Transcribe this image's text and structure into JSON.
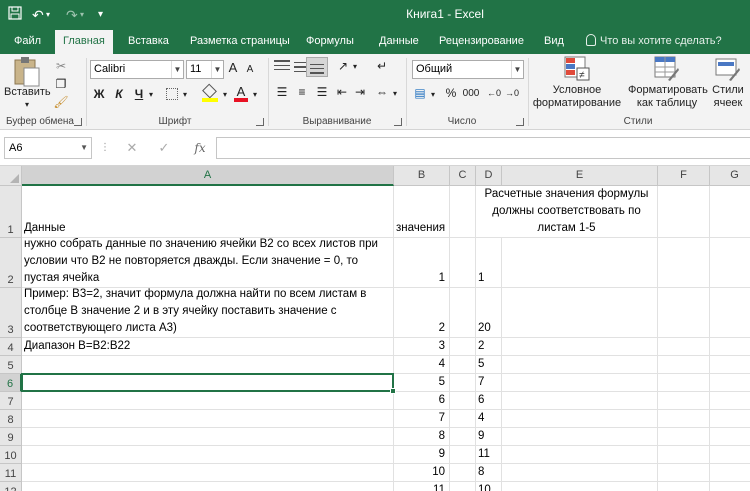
{
  "titlebar": {
    "title": "Книга1 - Excel"
  },
  "tabs": [
    {
      "label": "Файл",
      "active": false
    },
    {
      "label": "Главная",
      "active": true
    },
    {
      "label": "Вставка",
      "active": false
    },
    {
      "label": "Разметка страницы",
      "active": false
    },
    {
      "label": "Формулы",
      "active": false
    },
    {
      "label": "Данные",
      "active": false
    },
    {
      "label": "Рецензирование",
      "active": false
    },
    {
      "label": "Вид",
      "active": false
    }
  ],
  "tell_me": "Что вы хотите сделать?",
  "ribbon": {
    "clipboard": {
      "paste_label": "Вставить",
      "group_label": "Буфер обмена"
    },
    "font": {
      "font_name": "Calibri",
      "font_size": "11",
      "group_label": "Шрифт",
      "bold": "Ж",
      "italic": "К",
      "underline": "Ч",
      "grow": "A",
      "shrink": "A"
    },
    "alignment": {
      "group_label": "Выравнивание"
    },
    "number": {
      "format": "Общий",
      "group_label": "Число",
      "percent": "%",
      "thousands": "000"
    },
    "styles": {
      "conditional_line1": "Условное",
      "conditional_line2": "форматирование",
      "table_line1": "Форматировать",
      "table_line2": "как таблицу",
      "cell_line1": "Стили",
      "cell_line2": "ячеек",
      "group_label": "Стили"
    }
  },
  "formula_bar": {
    "name_box": "A6",
    "fx": "fx",
    "content": ""
  },
  "grid": {
    "columns": [
      "A",
      "B",
      "C",
      "D",
      "E",
      "F",
      "G"
    ],
    "selected_column": "A",
    "selected_row": "6",
    "rows": [
      {
        "num": "1",
        "A": "Данные",
        "B": "значения",
        "C": "",
        "D": "Расчетные значения формулы должны соответствовать по листам 1-5"
      },
      {
        "num": "2",
        "A": "нужно собрать данные по значению ячейки В2 со всех листов при условии что В2 не повторяется дважды. Если значение = 0, то пустая ячейка",
        "B": "1",
        "C": "",
        "D": "1"
      },
      {
        "num": "3",
        "A": "Пример: В3=2, значит формула должна найти по всем листам в столбце В значение 2 и в эту ячейку поставить значение с соответствующего листа А3)",
        "B": "2",
        "C": "",
        "D": "20"
      },
      {
        "num": "4",
        "A": "Диапазон В=В2:В22",
        "B": "3",
        "C": "",
        "D": "2"
      },
      {
        "num": "5",
        "A": "",
        "B": "4",
        "C": "",
        "D": "5"
      },
      {
        "num": "6",
        "A": "",
        "B": "5",
        "C": "",
        "D": "7"
      },
      {
        "num": "7",
        "A": "",
        "B": "6",
        "C": "",
        "D": "6"
      },
      {
        "num": "8",
        "A": "",
        "B": "7",
        "C": "",
        "D": "4"
      },
      {
        "num": "9",
        "A": "",
        "B": "8",
        "C": "",
        "D": "9"
      },
      {
        "num": "10",
        "A": "",
        "B": "9",
        "C": "",
        "D": "11"
      },
      {
        "num": "11",
        "A": "",
        "B": "10",
        "C": "",
        "D": "8"
      },
      {
        "num": "12",
        "A": "",
        "B": "11",
        "C": "",
        "D": "10"
      }
    ]
  },
  "colors": {
    "accent": "#217346"
  }
}
